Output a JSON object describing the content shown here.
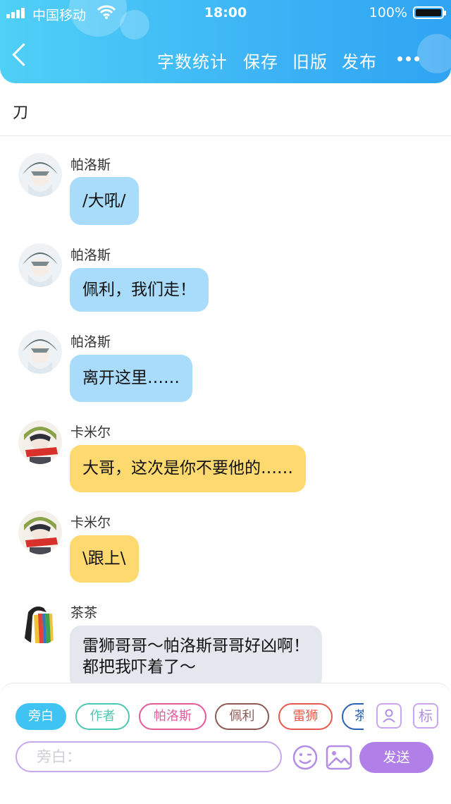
{
  "status_bar": {
    "carrier": "中国移动",
    "time": "18:00",
    "battery": "100%"
  },
  "nav": {
    "word_count": "字数统计",
    "save": "保存",
    "old_version": "旧版",
    "publish": "发布"
  },
  "title": "刀",
  "messages": [
    {
      "speaker": "帕洛斯",
      "text": "/大吼/",
      "color": "#a9dcfb"
    },
    {
      "speaker": "帕洛斯",
      "text": "佩利，我们走！",
      "color": "#a9dcfb"
    },
    {
      "speaker": "帕洛斯",
      "text": "离开这里……",
      "color": "#a9dcfb"
    },
    {
      "speaker": "卡米尔",
      "text": "大哥，这次是你不要他的……",
      "color": "#fed970"
    },
    {
      "speaker": "卡米尔",
      "text": "\\跟上\\",
      "color": "#fed970"
    },
    {
      "speaker": "茶茶",
      "line1": "雷狮哥哥～帕洛斯哥哥好凶啊！",
      "line2": "都把我吓着了～",
      "color": "#e4e8ee"
    }
  ],
  "roles": [
    {
      "label": "旁白",
      "color": "#3fc3f3",
      "selected": true
    },
    {
      "label": "作者",
      "color": "#4cc7b3"
    },
    {
      "label": "帕洛斯",
      "color": "#e45a9a"
    },
    {
      "label": "佩利",
      "color": "#8a5a55"
    },
    {
      "label": "雷狮",
      "color": "#e65a4e"
    },
    {
      "label": "茶",
      "color": "#2b5fb8"
    }
  ],
  "tools": {
    "tag_label": "标"
  },
  "composer": {
    "placeholder": "旁白：",
    "send_label": "发送"
  }
}
